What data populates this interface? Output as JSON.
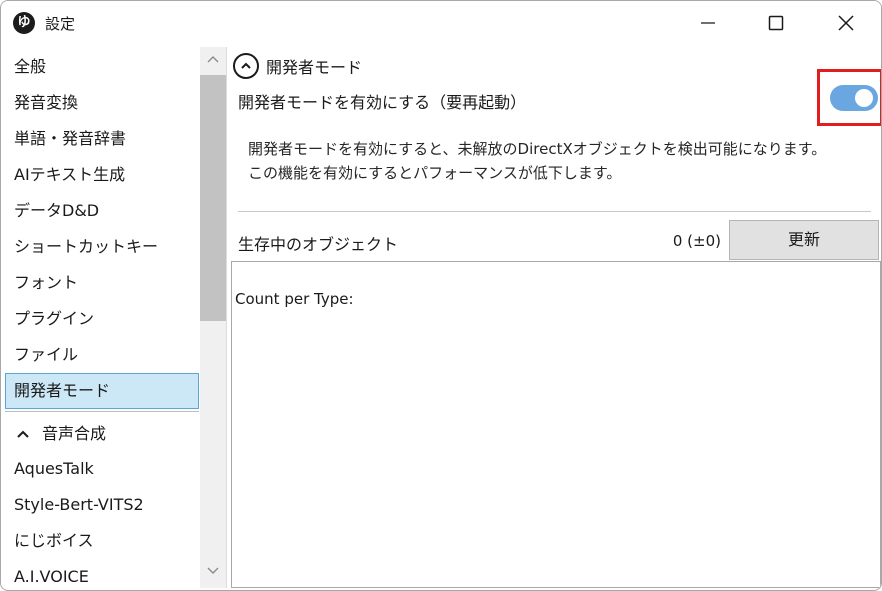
{
  "window": {
    "title": "設定",
    "app_icon_glyph": "ゆ"
  },
  "sidebar": {
    "items": [
      {
        "label": "全般"
      },
      {
        "label": "発音変換"
      },
      {
        "label": "単語・発音辞書"
      },
      {
        "label": "AIテキスト生成"
      },
      {
        "label": "データD&D"
      },
      {
        "label": "ショートカットキー"
      },
      {
        "label": "フォント"
      },
      {
        "label": "プラグイン"
      },
      {
        "label": "ファイル"
      },
      {
        "label": "開発者モード",
        "selected": true
      }
    ],
    "section": {
      "label": "音声合成",
      "items": [
        {
          "label": "AquesTalk"
        },
        {
          "label": "Style-Bert-VITS2"
        },
        {
          "label": "にじボイス"
        },
        {
          "label": "A.I.VOICE"
        }
      ]
    }
  },
  "main": {
    "section_title": "開発者モード",
    "toggle_label": "開発者モードを有効にする（要再起動）",
    "toggle_on": true,
    "description_line1": "開発者モードを有効にすると、未解放のDirectXオブジェクトを検出可能になります。",
    "description_line2": "この機能を有効にするとパフォーマンスが低下します。",
    "objects_label": "生存中のオブジェクト",
    "objects_count": "0 (±0)",
    "refresh_label": "更新",
    "output_text": "Count per Type:"
  },
  "colors": {
    "toggle_on": "#6aa6e0",
    "selected_bg": "#cce8f6",
    "highlight_box": "#e31d1d"
  }
}
